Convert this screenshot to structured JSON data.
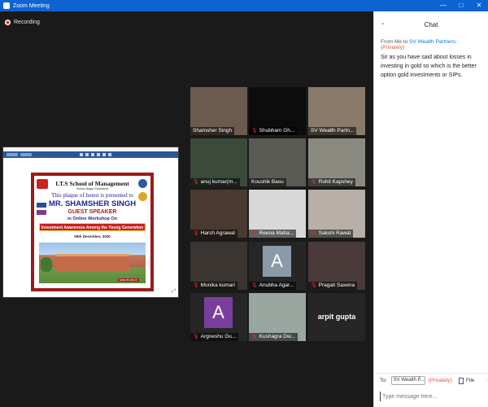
{
  "window": {
    "title": "Zoom Meeting",
    "controls": [
      "—",
      "□",
      "✕"
    ]
  },
  "recording": {
    "label": "Recording"
  },
  "share": {
    "school": "I.T.S School of Management",
    "location": "Mohan Nagar Ghaziabad",
    "honor": "This plaque of honor is presented to",
    "name": "MR. SHAMSHER SINGH",
    "guest": "GUEST SPEAKER",
    "workshop": "in Online Workshop On",
    "banner": "Investment Awareness Among the Young Generation",
    "date": "09th December, 2020",
    "web": "www.its.edu.in"
  },
  "participants": [
    {
      "name": "Shamsher Singh",
      "muted": false,
      "color": "#6d5a4e"
    },
    {
      "name": "Shubham Gh...",
      "muted": true,
      "color": "#0c0c0c"
    },
    {
      "name": "SV Wealth Partn...",
      "muted": false,
      "color": "#8a7a6a"
    },
    {
      "name": "anuj kumar(m...",
      "muted": true,
      "color": "#3b4a3a"
    },
    {
      "name": "Koushik Basu",
      "muted": false,
      "color": "#5a5a55"
    },
    {
      "name": "Rohit Kapshey",
      "muted": true,
      "color": "#8a8a80"
    },
    {
      "name": "Harsh Agrawal",
      "muted": true,
      "color": "#4a3a30"
    },
    {
      "name": "Reena Maha...",
      "muted": true,
      "color": "#d8d8d8"
    },
    {
      "name": "Sakshi Rawat",
      "muted": true,
      "color": "#b8b0a8",
      "active": true
    },
    {
      "name": "Monika kumari",
      "muted": true,
      "color": "#3a3530"
    },
    {
      "name": "Anubha Agar...",
      "muted": true,
      "avatar": "A",
      "avatar_color": "#8a9aa8"
    },
    {
      "name": "Pragati Saxena",
      "muted": true,
      "color": "#4a3a3a"
    },
    {
      "name": "Argneshu Gu...",
      "muted": true,
      "avatar": "A",
      "avatar_color": "#7a3f9e"
    },
    {
      "name": "Kushagra Dw...",
      "muted": true,
      "color": "#9aa6a0"
    },
    {
      "name": "",
      "muted": false,
      "center": "arpit gupta"
    }
  ],
  "chat": {
    "title": "Chat",
    "message": {
      "prefix": "From Me to",
      "to": "SV Wealth Partners:",
      "privacy": "(Privately)",
      "body": "Sir as you have said about losses in investing in gold so which is the better option gold investments or SIPs."
    },
    "to_label": "To:",
    "to_value": "SV Wealth P...",
    "to_privacy": "(Privately)",
    "file_label": "File",
    "more_label": "···",
    "placeholder": "Type message here..."
  }
}
